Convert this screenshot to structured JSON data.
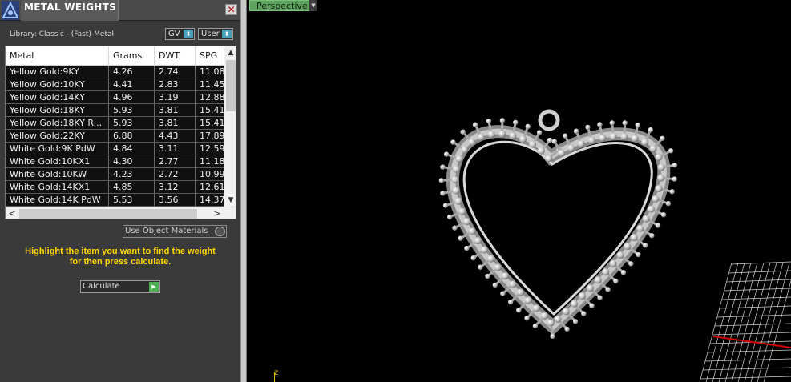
{
  "panel": {
    "title": "METAL WEIGHTS",
    "close_symbol": "✕",
    "library_label": "Library: Classic - (Fast)-Metal",
    "gv_label": "GV",
    "user_label": "User",
    "dropdown_arrow": "⬍",
    "table": {
      "columns": [
        "Metal",
        "Grams",
        "DWT",
        "SPG"
      ],
      "rows": [
        [
          "Yellow Gold:9KY",
          "4.26",
          "2.74",
          "11.08"
        ],
        [
          "Yellow Gold:10KY",
          "4.41",
          "2.83",
          "11.45"
        ],
        [
          "Yellow Gold:14KY",
          "4.96",
          "3.19",
          "12.88"
        ],
        [
          "Yellow Gold:18KY",
          "5.93",
          "3.81",
          "15.41"
        ],
        [
          "Yellow Gold:18KY R...",
          "5.93",
          "3.81",
          "15.41"
        ],
        [
          "Yellow Gold:22KY",
          "6.88",
          "4.43",
          "17.89"
        ],
        [
          "White Gold:9K PdW",
          "4.84",
          "3.11",
          "12.59"
        ],
        [
          "White Gold:10KX1",
          "4.30",
          "2.77",
          "11.18"
        ],
        [
          "White Gold:10KW",
          "4.23",
          "2.72",
          "10.99"
        ],
        [
          "White Gold:14KX1",
          "4.85",
          "3.12",
          "12.61"
        ],
        [
          "White Gold:14K PdW",
          "5.53",
          "3.56",
          "14.37"
        ]
      ],
      "scroll_up": "▲",
      "scroll_down": "▼",
      "scroll_left": "<",
      "scroll_right": ">"
    },
    "use_object_materials": "Use Object Materials",
    "instruction_line1": "Highlight the item you want to find the weight",
    "instruction_line2": "for then press calculate.",
    "calculate_label": "Calculate",
    "calculate_icon": "▶"
  },
  "viewport": {
    "view_name": "Perspective",
    "view_menu_arrow": "▼",
    "axis_label": "z"
  },
  "colors": {
    "panel_bg": "#3a3a3a",
    "instruction_text": "#ffd700",
    "perspective_tab": "#5da35d",
    "grid_line": "#cfcfcf",
    "grid_axis": "#cc0000"
  }
}
